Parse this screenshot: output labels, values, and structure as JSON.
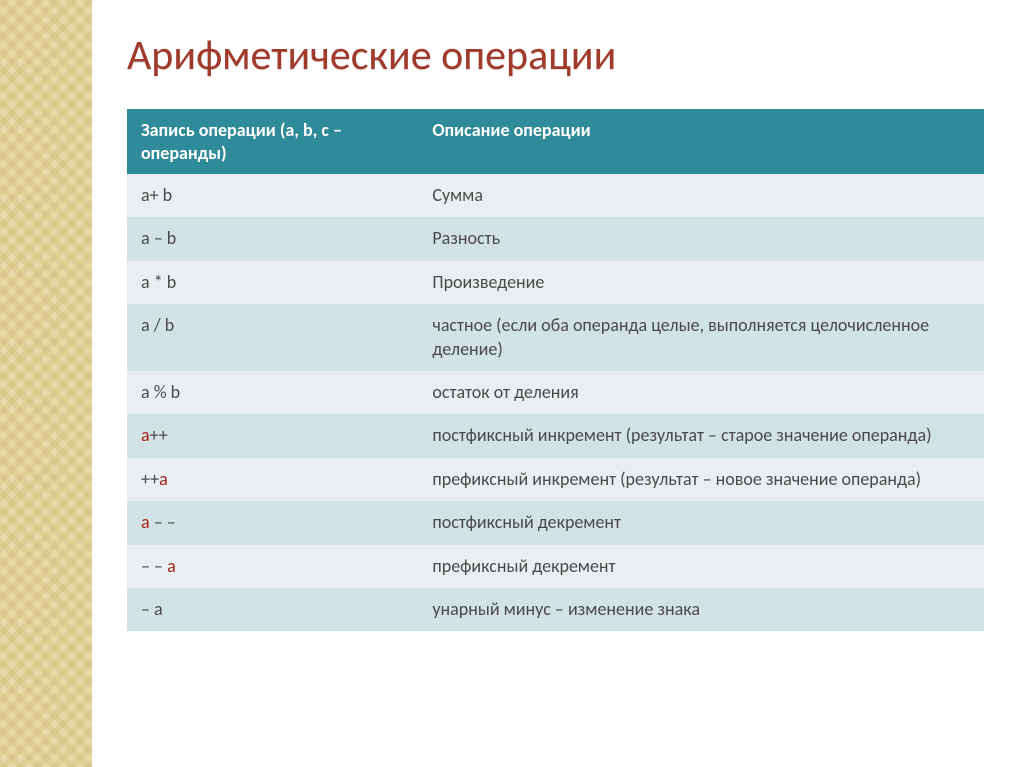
{
  "title": "Арифметические операции",
  "table": {
    "header": {
      "col1_line1": "Запись операции (a, b, c –",
      "col1_line2": "операнды)",
      "col2": "Описание операции"
    },
    "rows": [
      {
        "c1_pre": "a+ b",
        "c1_red": "",
        "c1_post": "",
        "c2": "Сумма"
      },
      {
        "c1_pre": "a – b",
        "c1_red": "",
        "c1_post": "",
        "c2": "Разность"
      },
      {
        "c1_pre": "a * b",
        "c1_red": "",
        "c1_post": "",
        "c2": "Произведение"
      },
      {
        "c1_pre": "a / b",
        "c1_red": "",
        "c1_post": "",
        "c2": "частное (если оба операнда целые, выполняется целочисленное деление)"
      },
      {
        "c1_pre": "a % b",
        "c1_red": "",
        "c1_post": "",
        "c2": "остаток от деления"
      },
      {
        "c1_pre": "",
        "c1_red": "a",
        "c1_post": "++",
        "c2": "постфиксный инкремент (результат – старое значение операнда)"
      },
      {
        "c1_pre": "++",
        "c1_red": "a",
        "c1_post": "",
        "c2": "префиксный инкремент (результат – новое значение операнда)"
      },
      {
        "c1_pre": "",
        "c1_red": "a",
        "c1_post": " – –",
        "c2": "постфиксный декремент"
      },
      {
        "c1_pre": "– – ",
        "c1_red": "a",
        "c1_post": "",
        "c2": "префиксный декремент"
      },
      {
        "c1_pre": "– a",
        "c1_red": "",
        "c1_post": "",
        "c2": "унарный минус – изменение знака"
      }
    ]
  }
}
